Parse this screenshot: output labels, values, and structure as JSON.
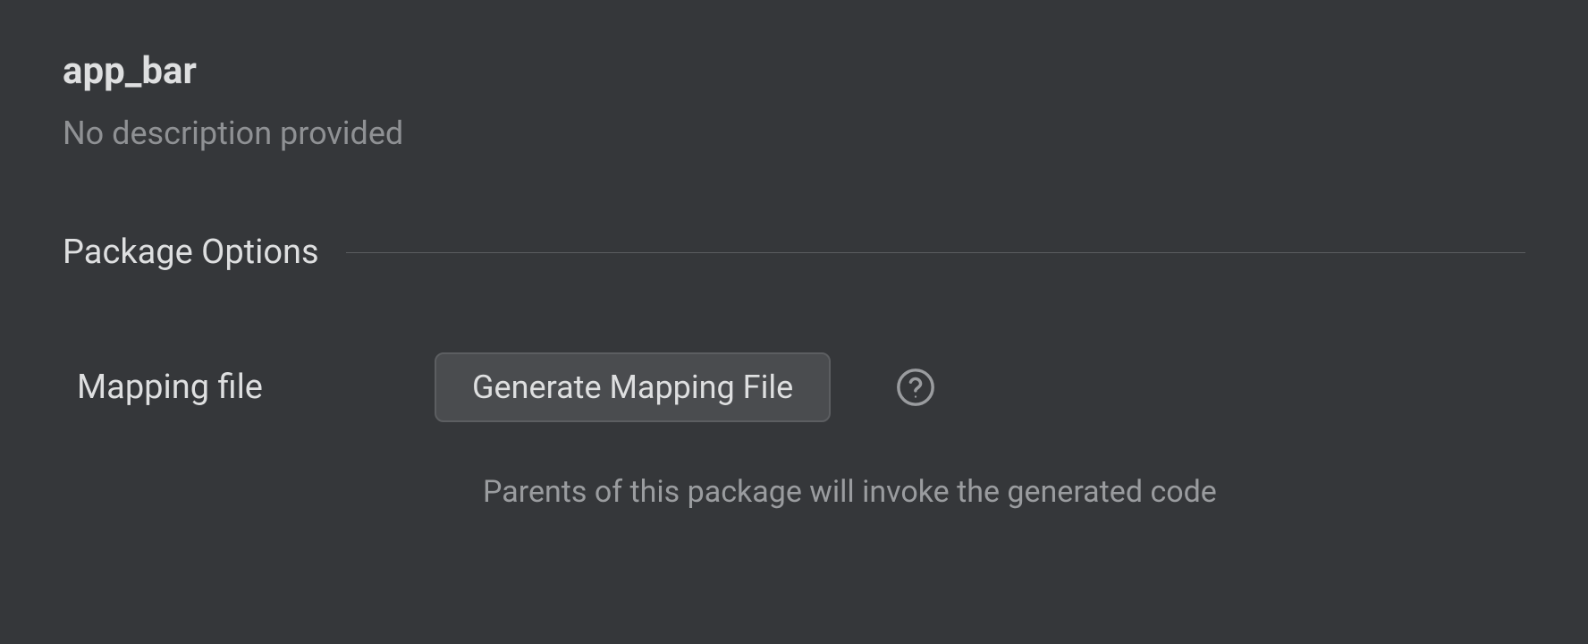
{
  "header": {
    "title": "app_bar",
    "description": "No description provided"
  },
  "section": {
    "title": "Package Options"
  },
  "options": {
    "mapping_file": {
      "label": "Mapping file",
      "button_label": "Generate Mapping File",
      "hint": "Parents of this package will invoke the generated code"
    }
  }
}
